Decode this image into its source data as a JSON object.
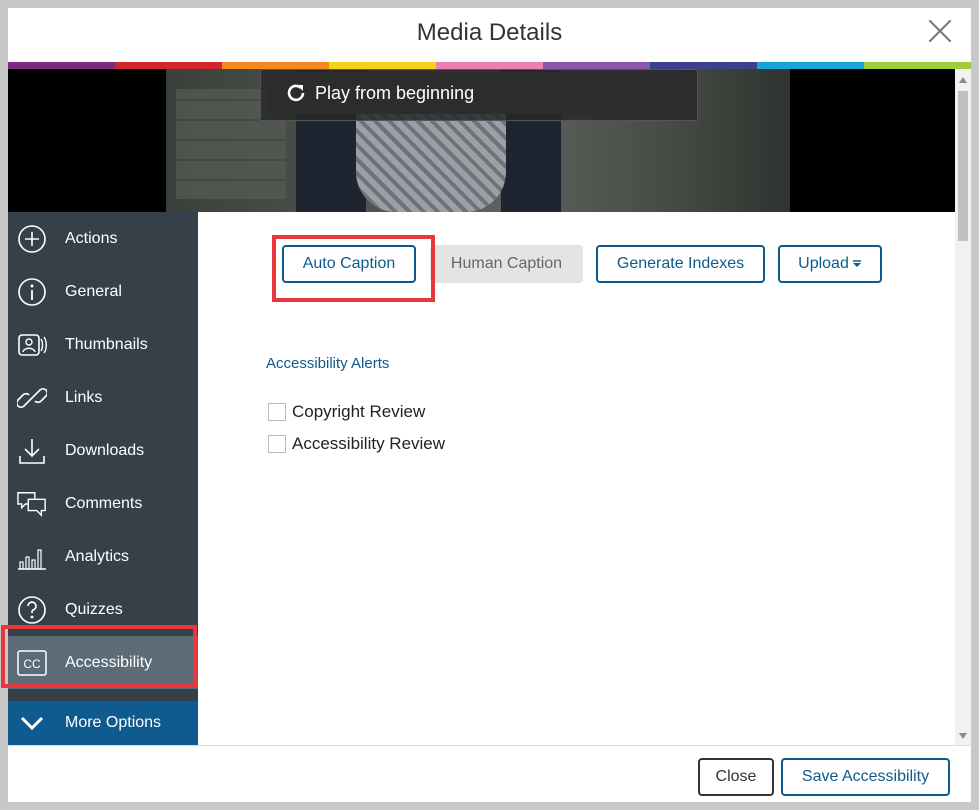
{
  "dialog": {
    "title": "Media Details"
  },
  "rainbow": [
    "#7b2c7d",
    "#d1262e",
    "#f38a1f",
    "#f5d21a",
    "#ee7fb4",
    "#8b57a8",
    "#3e418e",
    "#16a4d9",
    "#9fcc3b"
  ],
  "video": {
    "play_label": "Play from beginning"
  },
  "sidebar": {
    "items": [
      {
        "label": "Actions",
        "icon": "plus-circle-icon"
      },
      {
        "label": "General",
        "icon": "info-icon"
      },
      {
        "label": "Thumbnails",
        "icon": "thumbnail-icon"
      },
      {
        "label": "Links",
        "icon": "link-icon"
      },
      {
        "label": "Downloads",
        "icon": "download-icon"
      },
      {
        "label": "Comments",
        "icon": "comments-icon"
      },
      {
        "label": "Analytics",
        "icon": "analytics-icon"
      },
      {
        "label": "Quizzes",
        "icon": "question-icon"
      },
      {
        "label": "Accessibility",
        "icon": "cc-icon",
        "active": true
      }
    ],
    "more_options": "More Options"
  },
  "accessibility": {
    "buttons": {
      "auto_caption": "Auto Caption",
      "human_caption": "Human Caption",
      "generate_indexes": "Generate Indexes",
      "upload": "Upload"
    },
    "alerts_title": "Accessibility Alerts",
    "checks": [
      {
        "label": "Copyright Review",
        "checked": false
      },
      {
        "label": "Accessibility Review",
        "checked": false
      }
    ]
  },
  "footer": {
    "close_label": "Close",
    "save_label": "Save Accessibility"
  },
  "colors": {
    "accent": "#0e5a8e",
    "sidebar": "#354048",
    "highlight": "#e8383d"
  }
}
